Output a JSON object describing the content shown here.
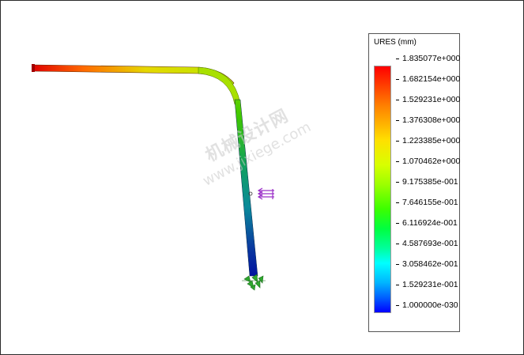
{
  "watermark": {
    "main": "机械设计网",
    "url": "www.jixiege.com"
  },
  "legend": {
    "title": "URES (mm)",
    "labels": [
      "1.835077e+000",
      "1.682154e+000",
      "1.529231e+000",
      "1.376308e+000",
      "1.223385e+000",
      "1.070462e+000",
      "9.175385e-001",
      "7.646155e-001",
      "6.116924e-001",
      "4.587693e-001",
      "3.058462e-001",
      "1.529231e-001",
      "1.000000e-030"
    ]
  },
  "colors": {
    "max": "#ff0000",
    "min": "#0000ff",
    "load_arrow": "#9b30c8",
    "fixture": "#2fa82f"
  }
}
